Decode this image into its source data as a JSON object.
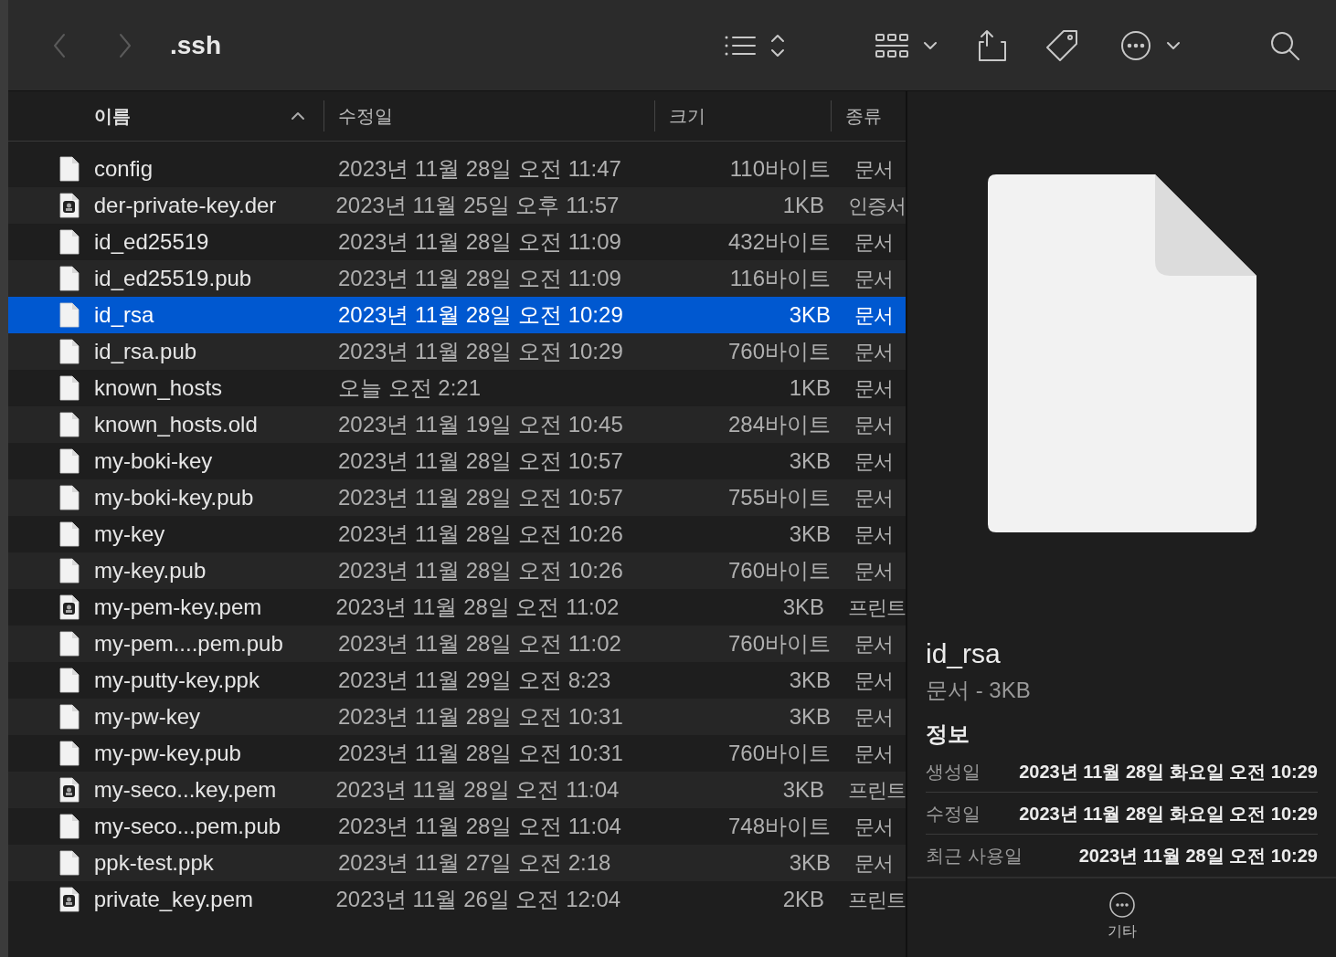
{
  "toolbar": {
    "title": ".ssh",
    "back_disabled": true,
    "forward_disabled": true
  },
  "columns": [
    {
      "label": "이름",
      "sorted": true
    },
    {
      "label": "수정일",
      "sorted": false
    },
    {
      "label": "크기",
      "sorted": false
    },
    {
      "label": "종류",
      "sorted": false
    }
  ],
  "files": [
    {
      "name": "config",
      "modified": "2023년 11월 28일 오전 11:47",
      "size": "110바이트",
      "type": "문서",
      "kind": "document",
      "selected": false
    },
    {
      "name": "der-private-key.der",
      "modified": "2023년 11월 25일 오후 11:57",
      "size": "1KB",
      "type": "인증서",
      "kind": "certificate",
      "selected": false
    },
    {
      "name": "id_ed25519",
      "modified": "2023년 11월 28일 오전 11:09",
      "size": "432바이트",
      "type": "문서",
      "kind": "document",
      "selected": false
    },
    {
      "name": "id_ed25519.pub",
      "modified": "2023년 11월 28일 오전 11:09",
      "size": "116바이트",
      "type": "문서",
      "kind": "document",
      "selected": false
    },
    {
      "name": "id_rsa",
      "modified": "2023년 11월 28일 오전 10:29",
      "size": "3KB",
      "type": "문서",
      "kind": "document",
      "selected": true
    },
    {
      "name": "id_rsa.pub",
      "modified": "2023년 11월 28일 오전 10:29",
      "size": "760바이트",
      "type": "문서",
      "kind": "document",
      "selected": false
    },
    {
      "name": "known_hosts",
      "modified": "오늘 오전 2:21",
      "size": "1KB",
      "type": "문서",
      "kind": "document",
      "selected": false
    },
    {
      "name": "known_hosts.old",
      "modified": "2023년 11월 19일 오전 10:45",
      "size": "284바이트",
      "type": "문서",
      "kind": "document",
      "selected": false
    },
    {
      "name": "my-boki-key",
      "modified": "2023년 11월 28일 오전 10:57",
      "size": "3KB",
      "type": "문서",
      "kind": "document",
      "selected": false
    },
    {
      "name": "my-boki-key.pub",
      "modified": "2023년 11월 28일 오전 10:57",
      "size": "755바이트",
      "type": "문서",
      "kind": "document",
      "selected": false
    },
    {
      "name": "my-key",
      "modified": "2023년 11월 28일 오전 10:26",
      "size": "3KB",
      "type": "문서",
      "kind": "document",
      "selected": false
    },
    {
      "name": "my-key.pub",
      "modified": "2023년 11월 28일 오전 10:26",
      "size": "760바이트",
      "type": "문서",
      "kind": "document",
      "selected": false
    },
    {
      "name": "my-pem-key.pem",
      "modified": "2023년 11월 28일 오전 11:02",
      "size": "3KB",
      "type": "프린트",
      "kind": "certificate",
      "selected": false
    },
    {
      "name": "my-pem....pem.pub",
      "modified": "2023년 11월 28일 오전 11:02",
      "size": "760바이트",
      "type": "문서",
      "kind": "document",
      "selected": false
    },
    {
      "name": "my-putty-key.ppk",
      "modified": "2023년 11월 29일 오전 8:23",
      "size": "3KB",
      "type": "문서",
      "kind": "document",
      "selected": false
    },
    {
      "name": "my-pw-key",
      "modified": "2023년 11월 28일 오전 10:31",
      "size": "3KB",
      "type": "문서",
      "kind": "document",
      "selected": false
    },
    {
      "name": "my-pw-key.pub",
      "modified": "2023년 11월 28일 오전 10:31",
      "size": "760바이트",
      "type": "문서",
      "kind": "document",
      "selected": false
    },
    {
      "name": "my-seco...key.pem",
      "modified": "2023년 11월 28일 오전 11:04",
      "size": "3KB",
      "type": "프린트",
      "kind": "certificate",
      "selected": false
    },
    {
      "name": "my-seco...pem.pub",
      "modified": "2023년 11월 28일 오전 11:04",
      "size": "748바이트",
      "type": "문서",
      "kind": "document",
      "selected": false
    },
    {
      "name": "ppk-test.ppk",
      "modified": "2023년 11월 27일 오전 2:18",
      "size": "3KB",
      "type": "문서",
      "kind": "document",
      "selected": false
    },
    {
      "name": "private_key.pem",
      "modified": "2023년 11월 26일 오전 12:04",
      "size": "2KB",
      "type": "프린트",
      "kind": "certificate",
      "selected": false
    }
  ],
  "preview": {
    "name": "id_rsa",
    "subtitle": "문서 - 3KB",
    "section": "정보",
    "info": [
      {
        "label": "생성일",
        "value": "2023년 11월 28일 화요일 오전 10:29"
      },
      {
        "label": "수정일",
        "value": "2023년 11월 28일 화요일 오전 10:29"
      },
      {
        "label": "최근 사용일",
        "value": "2023년 11월 28일 오전 10:29"
      }
    ],
    "more_label": "기타"
  }
}
